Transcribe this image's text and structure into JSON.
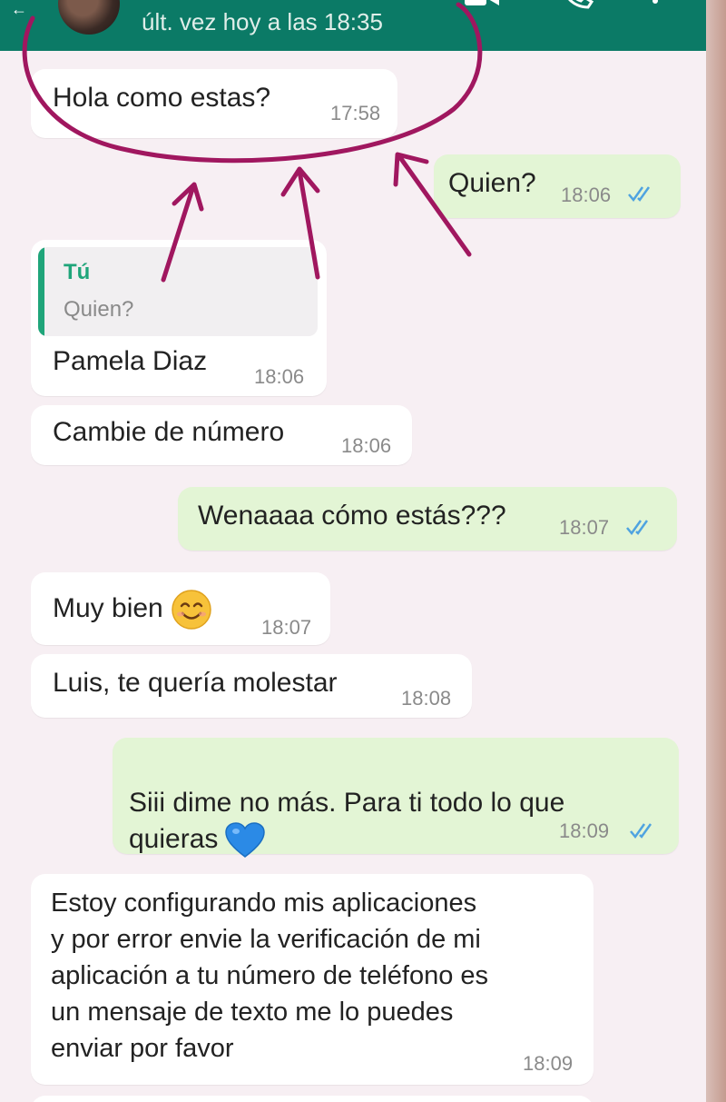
{
  "header": {
    "last_seen": "últ. vez hoy a las 18:35"
  },
  "icons": [
    "back-icon",
    "avatar",
    "video-call-icon",
    "voice-call-icon",
    "more-menu-icon",
    "double-check-icon",
    "smiling-face-emoji",
    "blue-heart-emoji"
  ],
  "colors": {
    "header": "#0b7a66",
    "chat_background": "#f7eff3",
    "incoming_bubble": "#ffffff",
    "outgoing_bubble": "#e3f5d5",
    "read_ticks": "#4fa3e0",
    "annotation": "#a0175f",
    "quote_accent": "#1fa57a"
  },
  "messages": [
    {
      "direction": "in",
      "text": "Hola como estas?",
      "time": "17:58"
    },
    {
      "direction": "out",
      "text": "Quien?",
      "time": "18:06",
      "status": "read"
    },
    {
      "direction": "in",
      "reply_to": {
        "author": "Tú",
        "text": "Quien?"
      },
      "text": "Pamela Diaz",
      "time": "18:06"
    },
    {
      "direction": "in",
      "text": "Cambie de número",
      "time": "18:06"
    },
    {
      "direction": "out",
      "text": "Wenaaaa cómo estás???",
      "time": "18:07",
      "status": "read"
    },
    {
      "direction": "in",
      "text": "Muy bien",
      "emoji": "smiling-face-emoji",
      "time": "18:07"
    },
    {
      "direction": "in",
      "text": "Luis, te quería molestar",
      "time": "18:08"
    },
    {
      "direction": "out",
      "text": "Siii dime no más. Para ti todo lo que\nquieras",
      "emoji": "blue-heart-emoji",
      "time": "18:09",
      "status": "read"
    },
    {
      "direction": "in",
      "text": "Estoy configurando mis aplicaciones\ny por error envie la verificación de mi\naplicación a tu número de teléfono es\nun mensaje de texto me lo puedes\nenviar por favor",
      "time": "18:09"
    }
  ]
}
